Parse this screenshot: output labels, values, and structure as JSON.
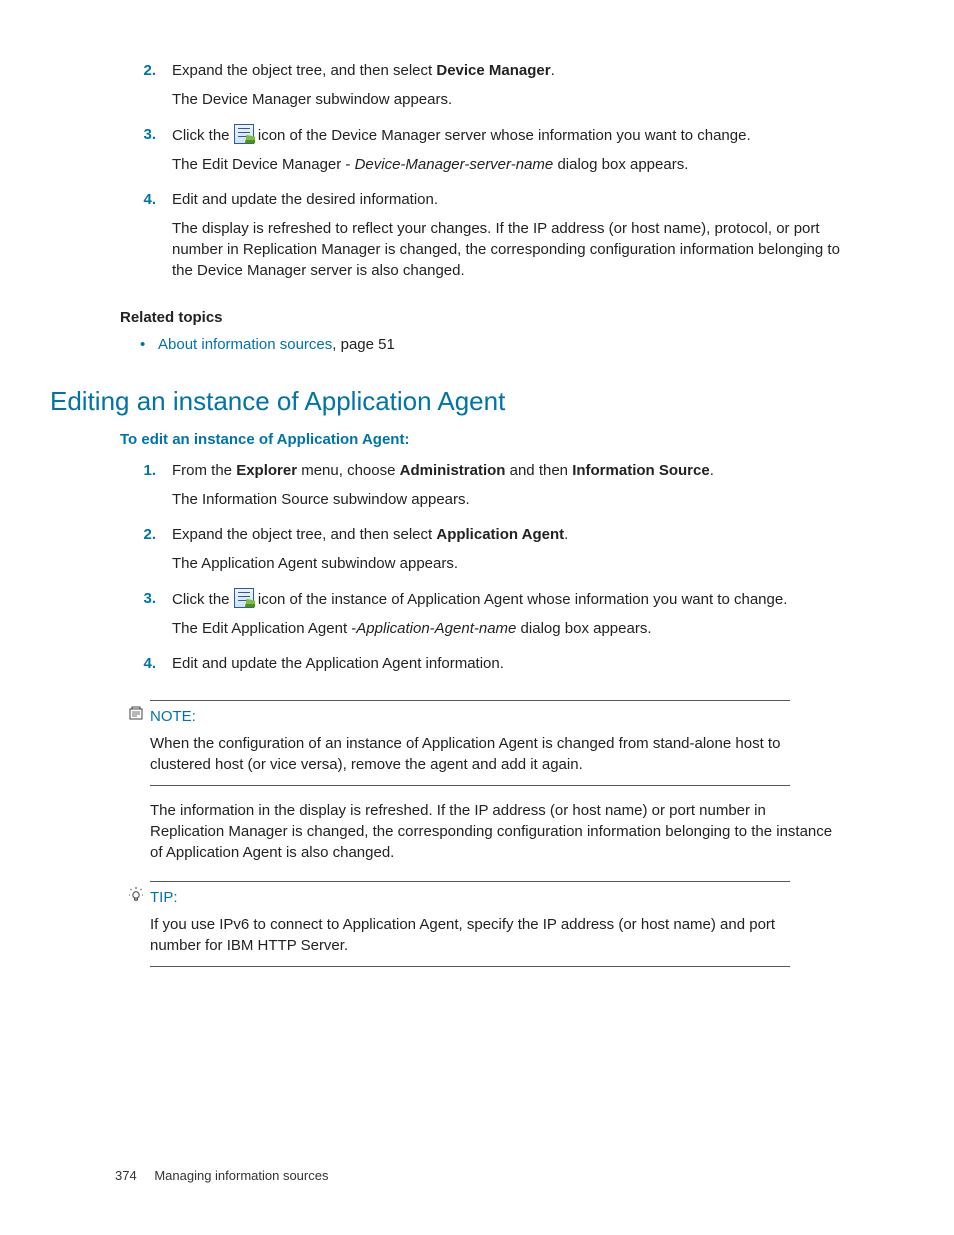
{
  "listA": {
    "items": [
      {
        "num": "2.",
        "line1a": "Expand the object tree, and then select ",
        "bold1": "Device Manager",
        "line1b": ".",
        "line2": "The Device Manager subwindow appears."
      },
      {
        "num": "3.",
        "line1a": "Click the ",
        "line1b": " icon of the Device Manager server whose information you want to change.",
        "line2a": "The Edit Device Manager - ",
        "italic": "Device-Manager-server-name",
        "line2b": " dialog box appears."
      },
      {
        "num": "4.",
        "line1": "Edit and update the desired information.",
        "line2": "The display is refreshed to reflect your changes. If the IP address (or host name), protocol, or port number in Replication Manager is changed, the corresponding configuration information belonging to the Device Manager server is also changed."
      }
    ]
  },
  "related": {
    "heading": "Related topics",
    "link": "About information sources",
    "suffix": ", page 51"
  },
  "h2": "Editing an instance of Application Agent",
  "sub": "To edit an instance of Application Agent:",
  "listB": {
    "items": [
      {
        "num": "1.",
        "a": "From the ",
        "b1": "Explorer",
        "c": " menu, choose ",
        "b2": "Administration",
        "d": " and then ",
        "b3": "Information Source",
        "e": ".",
        "line2": "The Information Source subwindow appears."
      },
      {
        "num": "2.",
        "a": "Expand the object tree, and then select ",
        "b1": "Application Agent",
        "c": ".",
        "line2": "The Application Agent subwindow appears."
      },
      {
        "num": "3.",
        "a": "Click the ",
        "c": " icon of the instance of Application Agent whose information you want to change.",
        "line2a": "The Edit Application Agent -",
        "italic": "Application-Agent-name",
        "line2b": " dialog box appears."
      },
      {
        "num": "4.",
        "a": "Edit and update the Application Agent information."
      }
    ]
  },
  "note": {
    "label": "NOTE:",
    "text": "When the configuration of an instance of Application Agent is changed from stand-alone host to clustered host (or vice versa), remove the agent and add it again."
  },
  "afterNote": "The information in the display is refreshed. If the IP address (or host name) or port number in Replication Manager is changed, the corresponding configuration information belonging to the instance of Application Agent is also changed.",
  "tip": {
    "label": "TIP:",
    "text": "If you use IPv6 to connect to Application Agent, specify the IP address (or host name) and port number for IBM HTTP Server."
  },
  "footer": {
    "page": "374",
    "title": "Managing information sources"
  }
}
